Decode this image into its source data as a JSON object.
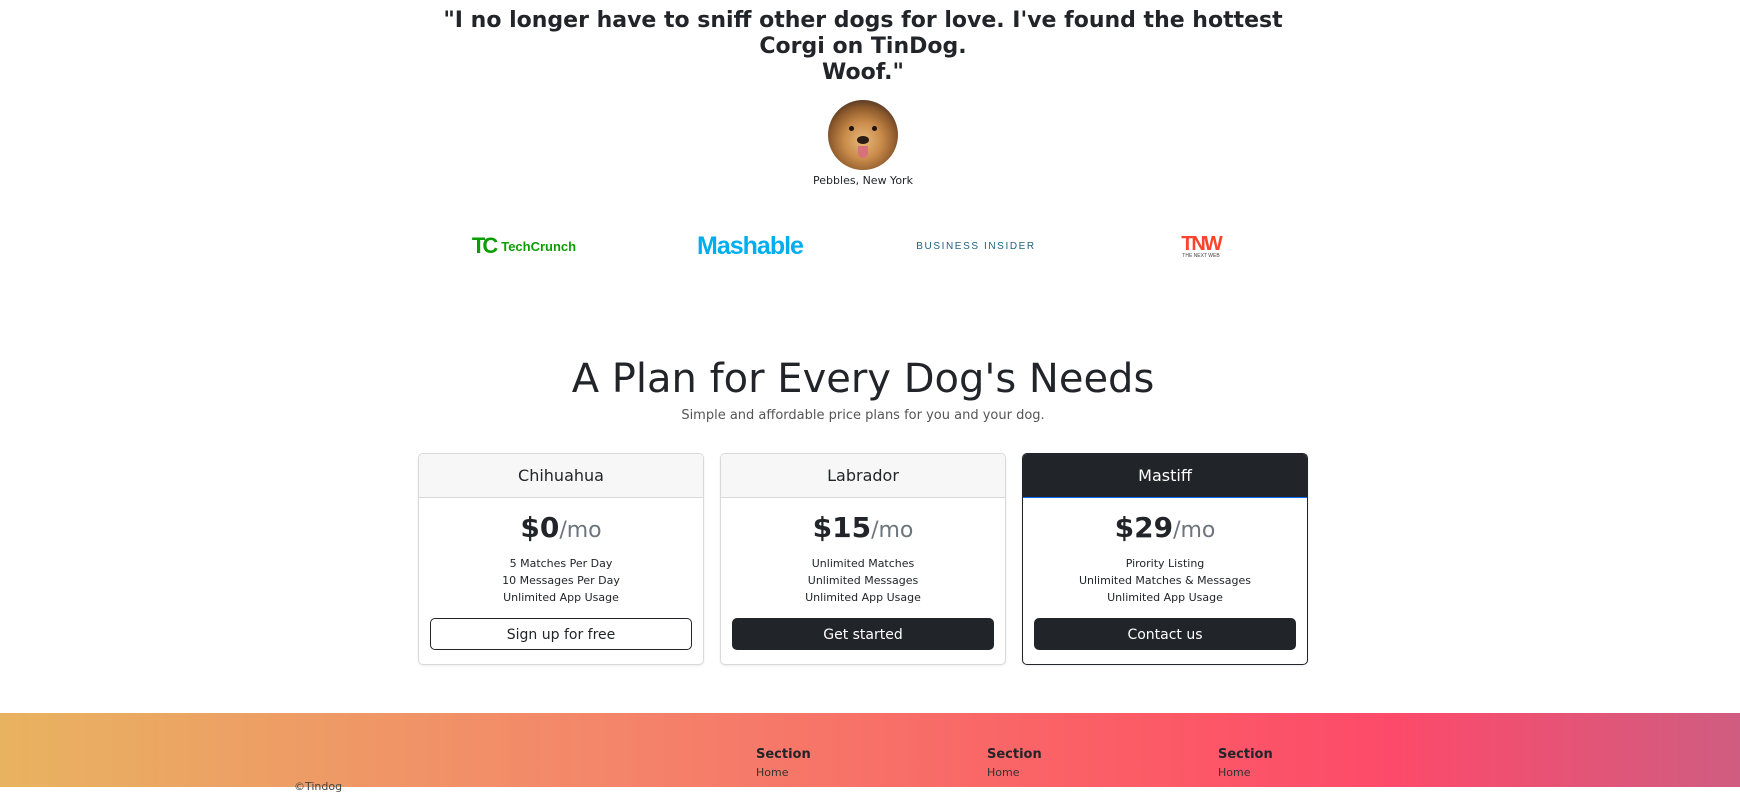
{
  "testimonial": {
    "quote_line1": "\"I no longer have to sniff other dogs for love. I've found the hottest Corgi on TinDog.",
    "quote_line2": "Woof.\"",
    "author": "Pebbles, New York"
  },
  "press": {
    "techcrunch_mark": "TC",
    "techcrunch_word": "TechCrunch",
    "mashable": "Mashable",
    "business_insider": "BUSINESS INSIDER",
    "tnw": "TNW",
    "tnw_sub": "THE NEXT WEB"
  },
  "pricing": {
    "title": "A Plan for Every Dog's Needs",
    "subtitle": "Simple and affordable price plans for you and your dog.",
    "plans": [
      {
        "name": "Chihuahua",
        "price": "$0",
        "period": "/mo",
        "features": [
          "5 Matches Per Day",
          "10 Messages Per Day",
          "Unlimited App Usage"
        ],
        "button": "Sign up for free"
      },
      {
        "name": "Labrador",
        "price": "$15",
        "period": "/mo",
        "features": [
          "Unlimited Matches",
          "Unlimited Messages",
          "Unlimited App Usage"
        ],
        "button": "Get started"
      },
      {
        "name": "Mastiff",
        "price": "$29",
        "period": "/mo",
        "features": [
          "Pirority Listing",
          "Unlimited Matches & Messages",
          "Unlimited App Usage"
        ],
        "button": "Contact us"
      }
    ]
  },
  "footer": {
    "copyright": "©Tindog",
    "columns": [
      {
        "heading": "Section",
        "link": "Home"
      },
      {
        "heading": "Section",
        "link": "Home"
      },
      {
        "heading": "Section",
        "link": "Home"
      }
    ]
  }
}
